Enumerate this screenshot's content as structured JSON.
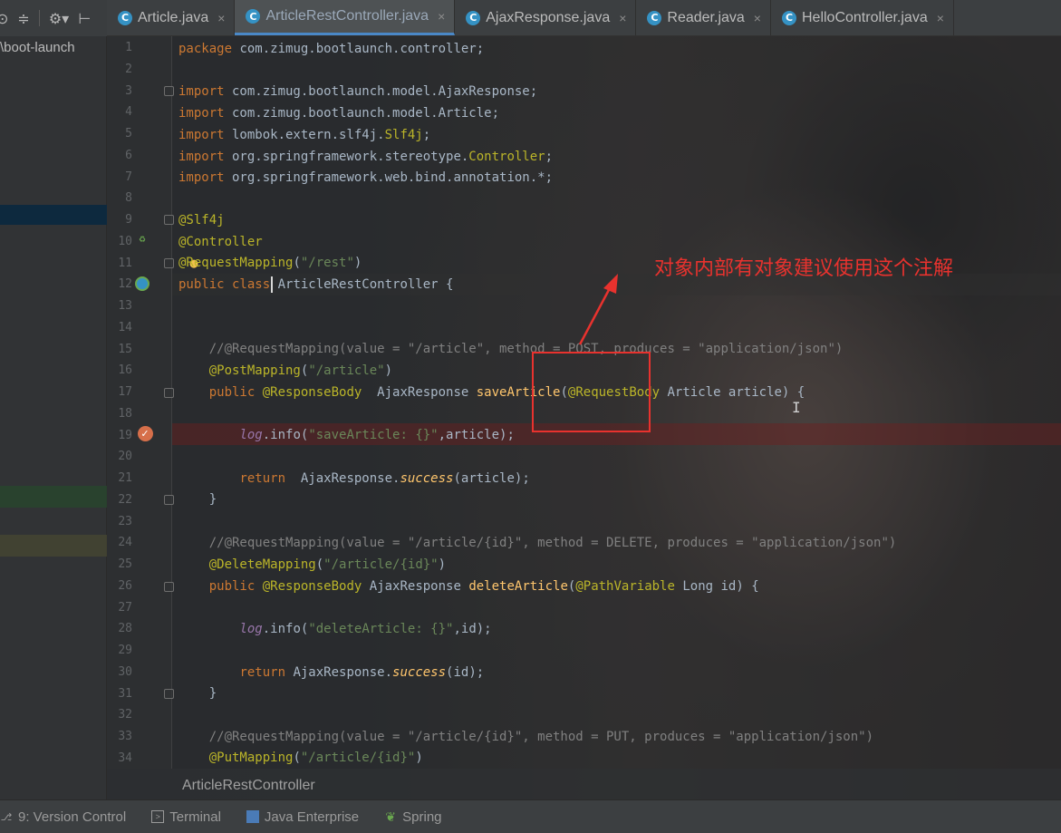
{
  "project_path": "\\boot-launch",
  "toolbar": {
    "icons": [
      "target-icon",
      "collapse-icon",
      "gear-icon",
      "hide-icon"
    ]
  },
  "tabs": [
    {
      "label": "Article.java",
      "active": false
    },
    {
      "label": "ArticleRestController.java",
      "active": true
    },
    {
      "label": "AjaxResponse.java",
      "active": false
    },
    {
      "label": "Reader.java",
      "active": false
    },
    {
      "label": "HelloController.java",
      "active": false
    }
  ],
  "tab_icon_glyph": "C",
  "tab_close_glyph": "×",
  "editor": {
    "breakpoint_line": 19,
    "current_line": 12,
    "lines": [
      {
        "n": "1"
      },
      {
        "n": "2"
      },
      {
        "n": "3"
      },
      {
        "n": "4"
      },
      {
        "n": "5"
      },
      {
        "n": "6"
      },
      {
        "n": "7"
      },
      {
        "n": "8"
      },
      {
        "n": "9"
      },
      {
        "n": "10"
      },
      {
        "n": "11"
      },
      {
        "n": "12"
      },
      {
        "n": "13"
      },
      {
        "n": "14"
      },
      {
        "n": "15"
      },
      {
        "n": "16"
      },
      {
        "n": "17"
      },
      {
        "n": "18"
      },
      {
        "n": "19"
      },
      {
        "n": "20"
      },
      {
        "n": "21"
      },
      {
        "n": "22"
      },
      {
        "n": "23"
      },
      {
        "n": "24"
      },
      {
        "n": "25"
      },
      {
        "n": "26"
      },
      {
        "n": "27"
      },
      {
        "n": "28"
      },
      {
        "n": "29"
      },
      {
        "n": "30"
      },
      {
        "n": "31"
      },
      {
        "n": "32"
      },
      {
        "n": "33"
      },
      {
        "n": "34"
      }
    ],
    "code": {
      "l1_kw": "package",
      "l1_rest": " com.zimug.bootlaunch.controller;",
      "l3_kw": "import",
      "l3_rest": " com.zimug.bootlaunch.model.AjaxResponse;",
      "l4_kw": "import",
      "l4_rest": " com.zimug.bootlaunch.model.Article;",
      "l5_kw": "import",
      "l5_rest": " lombok.extern.slf4j.",
      "l5_cls": "Slf4j",
      "l5_end": ";",
      "l6_kw": "import",
      "l6_rest": " org.springframework.stereotype.",
      "l6_cls": "Controller",
      "l6_end": ";",
      "l7_kw": "import",
      "l7_rest": " org.springframework.web.bind.annotation.*;",
      "l9_ann": "@Slf4j",
      "l10_ann": "@Controller",
      "l11_ann": "@RequestMapping",
      "l11_open": "(",
      "l11_str": "\"/rest\"",
      "l11_close": ")",
      "l12_kw": "public class",
      "l12_rest": " ArticleRestController {",
      "l15_cmt": "    //@RequestMapping(value = \"/article\", method = POST, produces = \"application/json\")",
      "l16_pad": "    ",
      "l16_ann": "@PostMapping",
      "l16_open": "(",
      "l16_str": "\"/article\"",
      "l16_close": ")",
      "l17_pad": "    ",
      "l17_kw": "public",
      "l17_sp": " ",
      "l17_ann": "@ResponseBody",
      "l17_mid": "  AjaxResponse ",
      "l17_fn": "saveArticle",
      "l17_open": "(",
      "l17_ann2": "@RequestBody",
      "l17_end": " Article article) {",
      "l19_pad": "        ",
      "l19_it": "log",
      "l19_mid": ".info(",
      "l19_str": "\"saveArticle: {}\"",
      "l19_end": ",article);",
      "l21_pad": "        ",
      "l21_kw": "return",
      "l21_mid": "  AjaxResponse.",
      "l21_sit": "success",
      "l21_end": "(article);",
      "l22": "    }",
      "l24_cmt": "    //@RequestMapping(value = \"/article/{id}\", method = DELETE, produces = \"application/json\")",
      "l25_pad": "    ",
      "l25_ann": "@DeleteMapping",
      "l25_open": "(",
      "l25_str": "\"/article/{id}\"",
      "l25_close": ")",
      "l26_pad": "    ",
      "l26_kw": "public",
      "l26_sp": " ",
      "l26_ann": "@ResponseBody",
      "l26_mid": " AjaxResponse ",
      "l26_fn": "deleteArticle",
      "l26_open": "(",
      "l26_ann2": "@PathVariable",
      "l26_end": " Long id) {",
      "l28_pad": "        ",
      "l28_it": "log",
      "l28_mid": ".info(",
      "l28_str": "\"deleteArticle: {}\"",
      "l28_end": ",id);",
      "l30_pad": "        ",
      "l30_kw": "return",
      "l30_mid": " AjaxResponse.",
      "l30_sit": "success",
      "l30_end": "(id);",
      "l31": "    }",
      "l33_cmt": "    //@RequestMapping(value = \"/article/{id}\", method = PUT, produces = \"application/json\")",
      "l34_pad": "    ",
      "l34_ann": "@PutMapping",
      "l34_open": "(",
      "l34_str": "\"/article/{id}\"",
      "l34_close": ")"
    }
  },
  "annotation_note": "对象内部有对象建议使用这个注解",
  "annotation_color": "#e8322e",
  "breadcrumb": "ArticleRestController",
  "status_bar": [
    {
      "label": "9: Version Control",
      "icon": "version-control-icon"
    },
    {
      "label": "Terminal",
      "icon": "terminal-icon"
    },
    {
      "label": "Java Enterprise",
      "icon": "java-enterprise-icon"
    },
    {
      "label": "Spring",
      "icon": "spring-leaf-icon"
    }
  ]
}
